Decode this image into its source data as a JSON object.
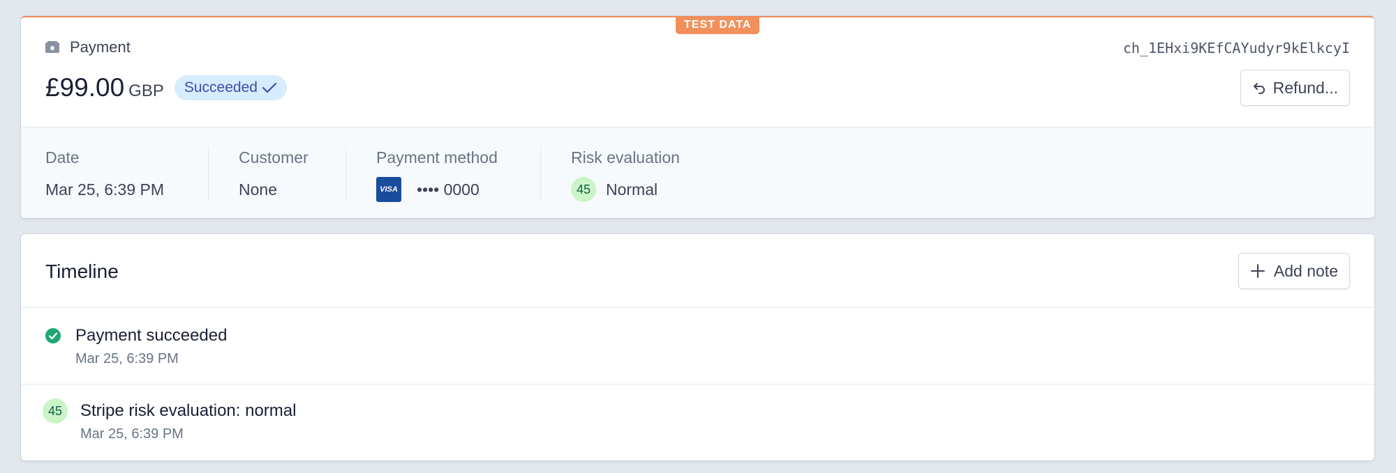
{
  "badge": {
    "test_data": "TEST DATA"
  },
  "payment": {
    "label": "Payment",
    "icon": "payment-icon",
    "charge_id": "ch_1EHxi9KEfCAYudyr9kElkcyI",
    "amount": "£99.00",
    "currency": "GBP",
    "status": "Succeeded",
    "refund_label": "Refund..."
  },
  "details": {
    "date": {
      "label": "Date",
      "value": "Mar 25, 6:39 PM"
    },
    "customer": {
      "label": "Customer",
      "value": "None"
    },
    "payment_method": {
      "label": "Payment method",
      "card_brand": "VISA",
      "value": "•••• 0000"
    },
    "risk": {
      "label": "Risk evaluation",
      "score": "45",
      "value": "Normal"
    }
  },
  "timeline": {
    "title": "Timeline",
    "add_note_label": "Add note",
    "events": [
      {
        "title": "Payment succeeded",
        "time": "Mar 25, 6:39 PM",
        "icon": "check-circle-icon"
      },
      {
        "title": "Stripe risk evaluation: normal",
        "time": "Mar 25, 6:39 PM",
        "score": "45"
      }
    ]
  },
  "colors": {
    "test_accent": "#f2905c",
    "success": "#1ea672",
    "status_bg": "#d6ecff",
    "status_text": "#3d4eac",
    "risk_bg": "#cbf4c9"
  }
}
